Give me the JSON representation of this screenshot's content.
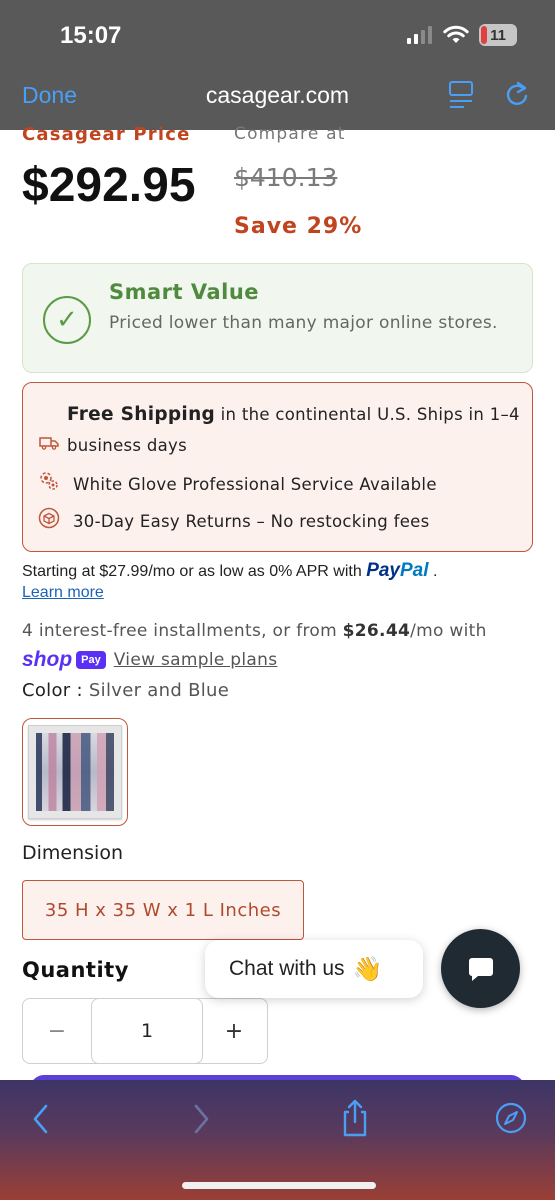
{
  "status_bar": {
    "time": "15:07",
    "battery": "11"
  },
  "browser": {
    "done_label": "Done",
    "url": "casagear.com"
  },
  "pricing": {
    "price_label": "Casagear Price",
    "compare_label": "Compare at",
    "price": "$292.95",
    "compare_price": "$410.13",
    "save": "Save 29%"
  },
  "smart_value": {
    "title": "Smart Value",
    "description": "Priced lower than many major online stores."
  },
  "shipping": {
    "free_shipping_bold": "Free Shipping",
    "free_shipping_rest": " in the continental U.S. Ships in 1–4 business days",
    "white_glove": "White Glove Professional Service Available",
    "returns": "30-Day Easy Returns – No restocking fees"
  },
  "financing": {
    "paypal_text": "Starting at $27.99/mo or as low as 0% APR with",
    "paypal_brand_a": "Pay",
    "paypal_brand_b": "Pal",
    "paypal_period": ".",
    "learn_more": "Learn more",
    "installments_prefix": "4 interest-free installments, or from ",
    "installments_amount": "$26.44",
    "installments_suffix": "/mo with",
    "shop_word": "shop",
    "pay_badge": "Pay",
    "sample_plans": "View sample plans"
  },
  "color": {
    "label": "Color :",
    "value": "Silver and Blue"
  },
  "dimension": {
    "label": "Dimension",
    "option": "35 H x 35 W x 1 L Inches"
  },
  "quantity": {
    "label": "Quantity",
    "value": "1",
    "minus": "−",
    "plus": "+"
  },
  "chat": {
    "label": "Chat with us",
    "emoji": "👋"
  },
  "colors": {
    "accent": "#c0441e",
    "green": "#4f8a3e",
    "topbar": "#595959",
    "link_blue": "#4a9ff5",
    "shop_purple": "#5a31f4"
  }
}
